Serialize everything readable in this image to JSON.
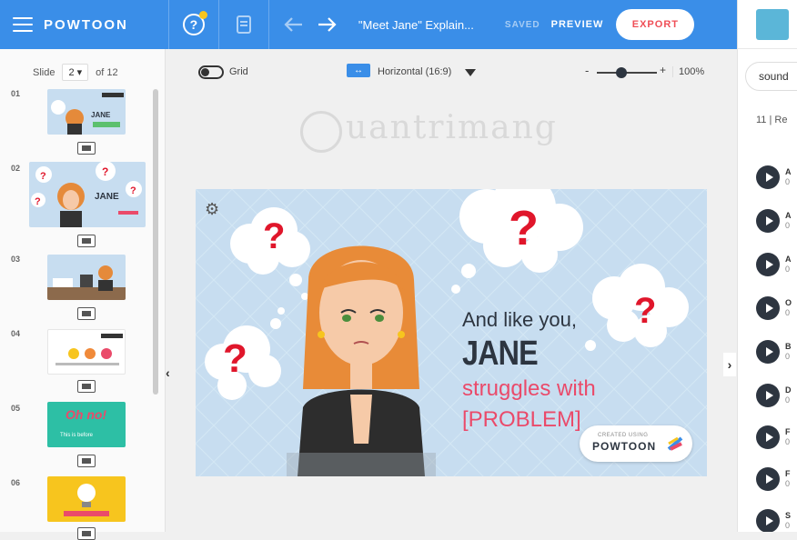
{
  "topbar": {
    "logo": "POWTOON",
    "title": "\"Meet Jane\" Explain...",
    "saved": "SAVED",
    "preview": "PREVIEW",
    "export": "EXPORT"
  },
  "sidebar": {
    "slide_label": "Slide",
    "slide_current": "2",
    "slide_of": "of 12",
    "slides": [
      {
        "num": "01"
      },
      {
        "num": "02"
      },
      {
        "num": "03"
      },
      {
        "num": "04"
      },
      {
        "num": "05"
      },
      {
        "num": "06"
      }
    ],
    "thumb_texts": {
      "s1_name": "JANE",
      "s2_name": "JANE",
      "s5_text": "Oh no!",
      "s5_sub": "This is before"
    }
  },
  "toolbar": {
    "grid_label": "Grid",
    "orientation_label": "Horizontal (16:9)",
    "zoom_minus": "-",
    "zoom_plus": "+",
    "zoom_value": "100%",
    "zoom_fraction": 0.5
  },
  "watermark": {
    "text": "uantrimang"
  },
  "canvas": {
    "line1": "And like you,",
    "line2": "JANE",
    "line3": "struggles with",
    "line4": "[PROBLEM]",
    "badge_small": "CREATED USING",
    "badge_brand": "POWTOON",
    "question_mark": "?"
  },
  "rightpanel": {
    "search_value": "sound",
    "results_count": "11",
    "results_label": "| Re",
    "items": [
      {
        "label": "A",
        "sub": "0"
      },
      {
        "label": "A",
        "sub": "0"
      },
      {
        "label": "A",
        "sub": "0"
      },
      {
        "label": "O",
        "sub": "0"
      },
      {
        "label": "B",
        "sub": "0"
      },
      {
        "label": "D",
        "sub": "0"
      },
      {
        "label": "F",
        "sub": "0"
      },
      {
        "label": "F",
        "sub": "0"
      },
      {
        "label": "S",
        "sub": "0"
      }
    ]
  },
  "colors": {
    "topbar": "#3a8ee8",
    "export_text": "#ef4e56",
    "canvas_bg": "#c7ddf0",
    "accent_pink": "#ea4a6a",
    "question_red": "#e0162b"
  },
  "icons": [
    "menu-icon",
    "help-icon",
    "notes-icon",
    "undo-icon",
    "redo-icon",
    "gear-icon",
    "play-icon",
    "add-slide-icon"
  ]
}
